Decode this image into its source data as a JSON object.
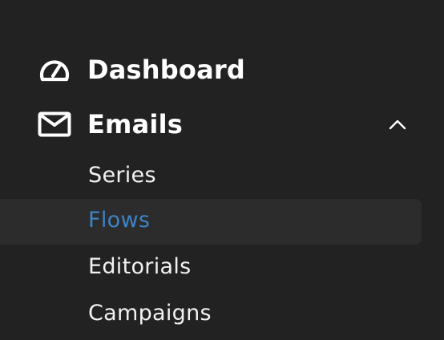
{
  "sidebar": {
    "items": [
      {
        "label": "Dashboard",
        "icon": "gauge-icon"
      },
      {
        "label": "Emails",
        "icon": "mail-icon",
        "expanded": true,
        "toggle_icon": "chevron-up-icon"
      }
    ],
    "emails_subitems": [
      {
        "label": "Series"
      },
      {
        "label": "Flows",
        "active": true
      },
      {
        "label": "Editorials"
      },
      {
        "label": "Campaigns"
      }
    ]
  },
  "colors": {
    "background": "#222222",
    "active_row_background": "#2c2c2c",
    "active_text": "#3d83c6",
    "text": "#ffffff"
  }
}
